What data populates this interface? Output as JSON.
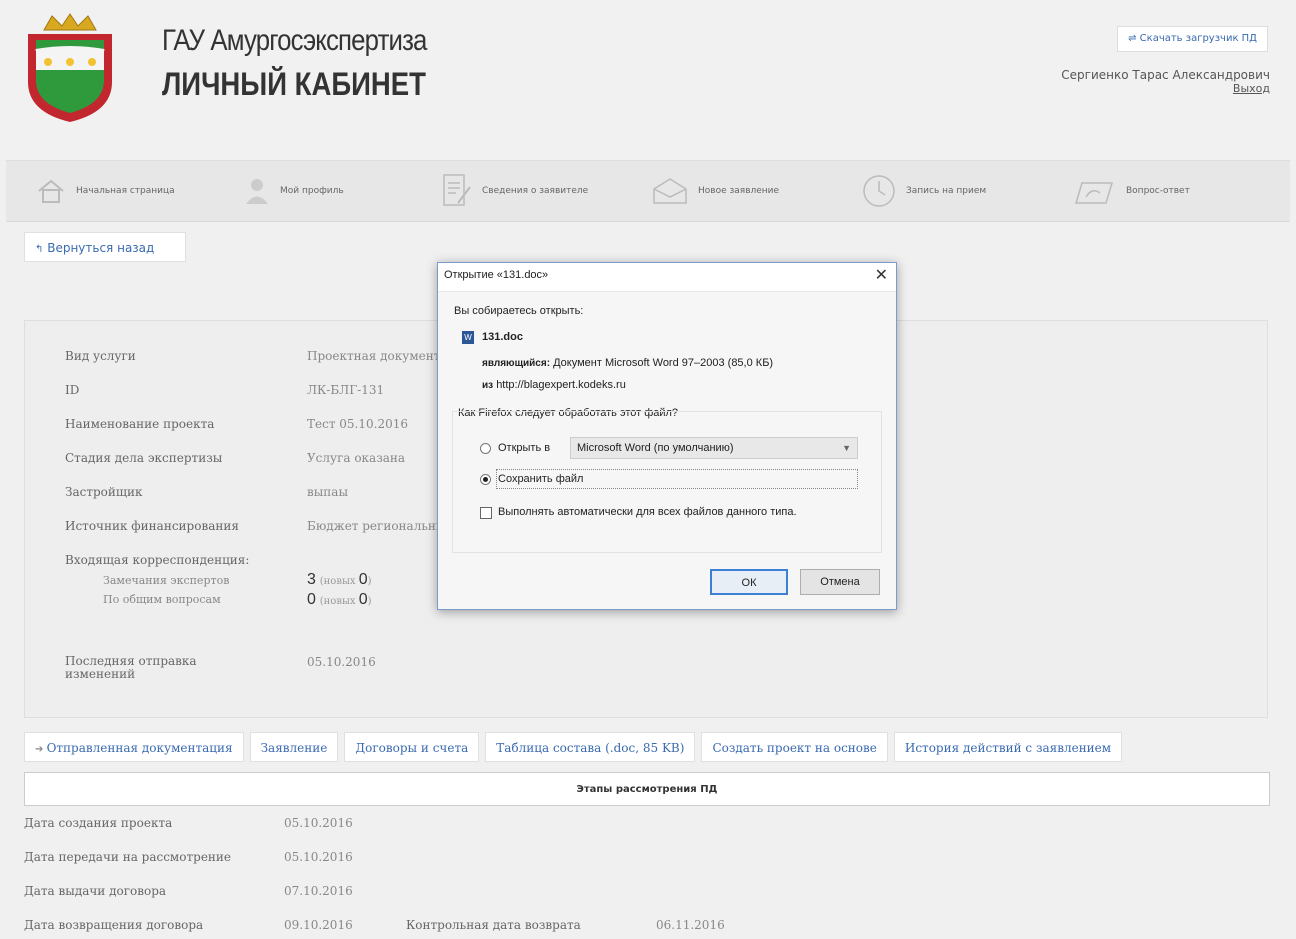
{
  "header": {
    "org_name": "ГАУ Амургосэкспертиза",
    "cabinet_title": "ЛИЧНЫЙ КАБИНЕТ",
    "download_button": "Скачать загрузчик ПД",
    "user_name": "Сергиенко Тарас Александрович",
    "logout": "Выход"
  },
  "nav": {
    "items": [
      {
        "label": "Начальная страница",
        "icon": "home-icon"
      },
      {
        "label": "Мой профиль",
        "icon": "user-icon"
      },
      {
        "label": "Сведения о заявителе",
        "icon": "edit-document-icon"
      },
      {
        "label": "Новое заявление",
        "icon": "envelope-icon"
      },
      {
        "label": "Запись на прием",
        "icon": "clock-icon"
      },
      {
        "label": "Вопрос-ответ",
        "icon": "chat-icon"
      }
    ]
  },
  "back_button": "Вернуться назад",
  "info": {
    "rows": [
      {
        "label": "Вид услуги",
        "value": "Проектная документ"
      },
      {
        "label": "ID",
        "value": "ЛК-БЛГ-131"
      },
      {
        "label": "Наименование проекта",
        "value": "Тест 05.10.2016"
      },
      {
        "label": "Стадия дела экспертизы",
        "value": "Услуга оказана"
      },
      {
        "label": "Застройщик",
        "value": "выпаы"
      },
      {
        "label": "Источник финансирования",
        "value": "Бюджет региональны"
      }
    ],
    "incoming_label": "Входящая корреспонденция:",
    "incoming": [
      {
        "label": "Замечания экспертов",
        "count": "3",
        "new_prefix": "(новых ",
        "new_count": "0",
        "new_suffix": ")"
      },
      {
        "label": "По общим вопросам",
        "count": "0",
        "new_prefix": "(новых ",
        "new_count": "0",
        "new_suffix": ")"
      }
    ],
    "last_sent_label": "Последняя отправка изменений",
    "last_sent_value": "05.10.2016"
  },
  "tabs": [
    {
      "label": "Отправленная документация",
      "active": true
    },
    {
      "label": "Заявление"
    },
    {
      "label": "Договоры и счета"
    },
    {
      "label": "Таблица состава (.doc, 85 KB)"
    },
    {
      "label": "Создать проект на основе"
    },
    {
      "label": "История действий с заявлением"
    }
  ],
  "stages": {
    "header": "Этапы рассмотрения ПД",
    "rows": [
      {
        "label": "Дата создания проекта",
        "value": "05.10.2016"
      },
      {
        "label": "Дата передачи на рассмотрение",
        "value": "05.10.2016"
      },
      {
        "label": "Дата выдачи договора",
        "value": "07.10.2016"
      },
      {
        "label": "Дата возвращения договора",
        "value": "09.10.2016",
        "extra_label": "Контрольная дата возврата",
        "extra_value": "06.11.2016"
      }
    ]
  },
  "dialog": {
    "title": "Открытие «131.doc»",
    "about_to_open": "Вы собираетесь открыть:",
    "file_name": "131.doc",
    "type_label": "являющийся:",
    "type_value": "Документ Microsoft Word 97–2003 (85,0 КБ)",
    "from_label": "из",
    "from_value": "http://blagexpert.kodeks.ru",
    "question": "Как Firefox следует обработать этот файл?",
    "open_with_label": "Открыть в",
    "open_with_app": "Microsoft Word (по умолчанию)",
    "save_file_label": "Сохранить файл",
    "auto_label": "Выполнять автоматически для всех файлов данного типа.",
    "ok": "ОК",
    "cancel": "Отмена",
    "selected_option": "save"
  },
  "colors": {
    "link": "#3a6ab0",
    "dialog_border": "#7a9cc8",
    "ok_focus": "#3c7fd4"
  }
}
